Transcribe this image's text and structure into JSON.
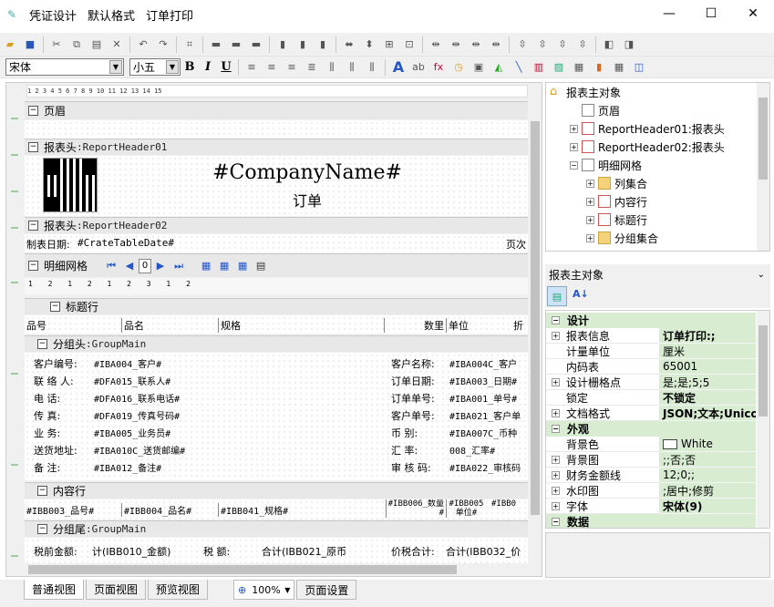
{
  "window": {
    "title_parts": [
      "凭证设计",
      "默认格式",
      "订单打印"
    ],
    "minimize": "—",
    "maximize": "☐",
    "close": "✕"
  },
  "toolbar2": {
    "font_name": "宋体",
    "font_size": "小五",
    "bold": "B",
    "italic": "I",
    "underline": "U"
  },
  "designer": {
    "ruler_text": "1 2 3 4 5 6 7 8 9 10 11 12 13 14 15",
    "bands": {
      "page_header": "页眉",
      "report_header1": "报表头",
      "report_header1_sub": ":ReportHeader01",
      "report_header2": "报表头",
      "report_header2_sub": ":ReportHeader02",
      "detail_grid": "明细网格",
      "title_row": "标题行",
      "group_header": "分组头",
      "group_header_sub": ":GroupMain",
      "content_row": "内容行",
      "group_footer": "分组尾",
      "group_footer_sub": ":GroupMain"
    },
    "company_name": "#CompanyName#",
    "order_title": "订单",
    "make_date_label": "制表日期:",
    "make_date_value": "#CrateTableDate#",
    "page_label": "页次",
    "nav_page": "0",
    "grid_ruler": "1 2 1 2 1 2 3 1 2",
    "title_columns": [
      "品号",
      "品名",
      "规格",
      "数里",
      "单位",
      "折"
    ],
    "group_left": [
      {
        "label": "客户编号:",
        "value": "#IBA004_客户#"
      },
      {
        "label": "联 络 人:",
        "value": "#DFA015_联系人#"
      },
      {
        "label": "电    话:",
        "value": "#DFA016_联系电话#"
      },
      {
        "label": "传    真:",
        "value": "#DFA019_传真号码#"
      },
      {
        "label": "业    务:",
        "value": "#IBA005_业务员#"
      },
      {
        "label": "送货地址:",
        "value": "#IBA010C_送货邮编#"
      },
      {
        "label": "备    注:",
        "value": "#IBA012_备注#"
      }
    ],
    "group_right": [
      {
        "label": "客户名称:",
        "value": "#IBA004C_客户"
      },
      {
        "label": "订单日期:",
        "value": "#IBA003_日期#"
      },
      {
        "label": "订单单号:",
        "value": "#IBA001_单号#"
      },
      {
        "label": "客户单号:",
        "value": "#IBA021_客户单"
      },
      {
        "label": "币    别:",
        "value": "#IBA007C_币种"
      },
      {
        "label": "汇    率:",
        "value": "008_汇率#"
      },
      {
        "label": "审 核 码:",
        "value": "#IBA022_审核码"
      }
    ],
    "content_cells": [
      "#IBB003_品号#",
      "#IBB004_品名#",
      "#IBB041_规格#",
      "#IBB006_数量#",
      "#IBB005单位#",
      "#IBB0"
    ],
    "footer": {
      "pretax_label": "税前金额:",
      "pretax_value": "计(IBB010_金额)",
      "tax_label": "税    额:",
      "tax_value": "合计(IBB021_原币",
      "total_label": "价税合计:",
      "total_value": "合计(IBB032_价"
    }
  },
  "tree": {
    "root": "报表主对象",
    "items": [
      {
        "label": "页眉",
        "indent": 1,
        "expander": ""
      },
      {
        "label": "ReportHeader01:报表头",
        "indent": 1,
        "expander": "+"
      },
      {
        "label": "ReportHeader02:报表头",
        "indent": 1,
        "expander": "+"
      },
      {
        "label": "明细网格",
        "indent": 1,
        "expander": "−"
      },
      {
        "label": "列集合",
        "indent": 2,
        "expander": "+"
      },
      {
        "label": "内容行",
        "indent": 2,
        "expander": "+"
      },
      {
        "label": "标题行",
        "indent": 2,
        "expander": "+"
      },
      {
        "label": "分组集合",
        "indent": 2,
        "expander": "+"
      }
    ]
  },
  "properties": {
    "header": "报表主对象",
    "sort_alpha": "A↓",
    "categories": [
      {
        "name": "设计",
        "rows": [
          {
            "key": "报表信息",
            "value": "订单打印:;",
            "bold": true,
            "exp": "+"
          },
          {
            "key": "计量单位",
            "value": "厘米",
            "bold": false,
            "exp": ""
          },
          {
            "key": "内码表",
            "value": "65001",
            "bold": false,
            "exp": ""
          },
          {
            "key": "设计栅格点",
            "value": "是;是;5;5",
            "bold": false,
            "exp": "+"
          },
          {
            "key": "锁定",
            "value": "不锁定",
            "bold": true,
            "exp": ""
          },
          {
            "key": "文档格式",
            "value": "JSON;文本;Unico",
            "bold": true,
            "exp": "+"
          }
        ]
      },
      {
        "name": "外观",
        "rows": [
          {
            "key": "背景色",
            "value": "White",
            "bold": false,
            "exp": "",
            "swatch": true
          },
          {
            "key": "背景图",
            "value": ";;否;否",
            "bold": false,
            "exp": "+"
          },
          {
            "key": "财务金额线",
            "value": "12;0;;",
            "bold": false,
            "exp": "+"
          },
          {
            "key": "水印图",
            "value": ";居中;修剪",
            "bold": false,
            "exp": "+"
          },
          {
            "key": "字体",
            "value": "宋体(9)",
            "bold": true,
            "exp": "+"
          }
        ]
      },
      {
        "name": "数据",
        "rows": []
      }
    ]
  },
  "bottom_tabs": [
    "普通视图",
    "页面视图",
    "预览视图"
  ],
  "zoom": "100%",
  "page_setup": "页面设置"
}
